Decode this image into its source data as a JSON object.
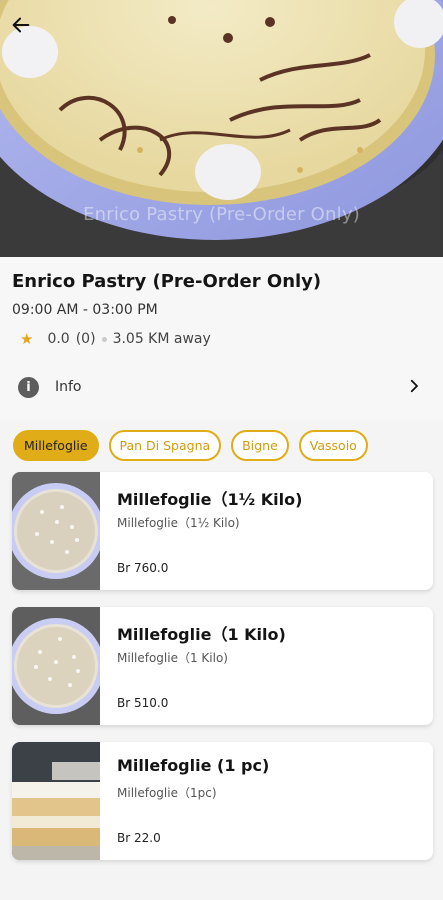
{
  "hero": {
    "caption": "Enrico Pastry (Pre-Order Only)"
  },
  "store": {
    "name": "Enrico Pastry (Pre-Order Only)",
    "hours": "09:00 AM - 03:00 PM",
    "rating": "0.0",
    "reviews": "(0)",
    "distance": "3.05 KM away"
  },
  "info_row": {
    "label": "Info"
  },
  "categories": [
    {
      "label": "Millefoglie",
      "active": true
    },
    {
      "label": "Pan Di Spagna",
      "active": false
    },
    {
      "label": "Bigne",
      "active": false
    },
    {
      "label": "Vassoio",
      "active": false
    }
  ],
  "products": [
    {
      "title": "Millefoglie（1½ Kilo)",
      "subtitle": "Millefoglie（1½ Kilo)",
      "price": "Br 760.0"
    },
    {
      "title": "Millefoglie（1 Kilo)",
      "subtitle": "Millefoglie（1 Kilo)",
      "price": "Br 510.0"
    },
    {
      "title": "Millefoglie (1 pc)",
      "subtitle": "Millefoglie（1pc)",
      "price": "Br 22.0"
    }
  ],
  "colors": {
    "accent": "#e0ac17",
    "star": "#e7a51c"
  },
  "icons": {
    "back": "arrow-left-icon",
    "info": "info-icon",
    "chevron": "chevron-right-icon",
    "star": "star-icon"
  }
}
